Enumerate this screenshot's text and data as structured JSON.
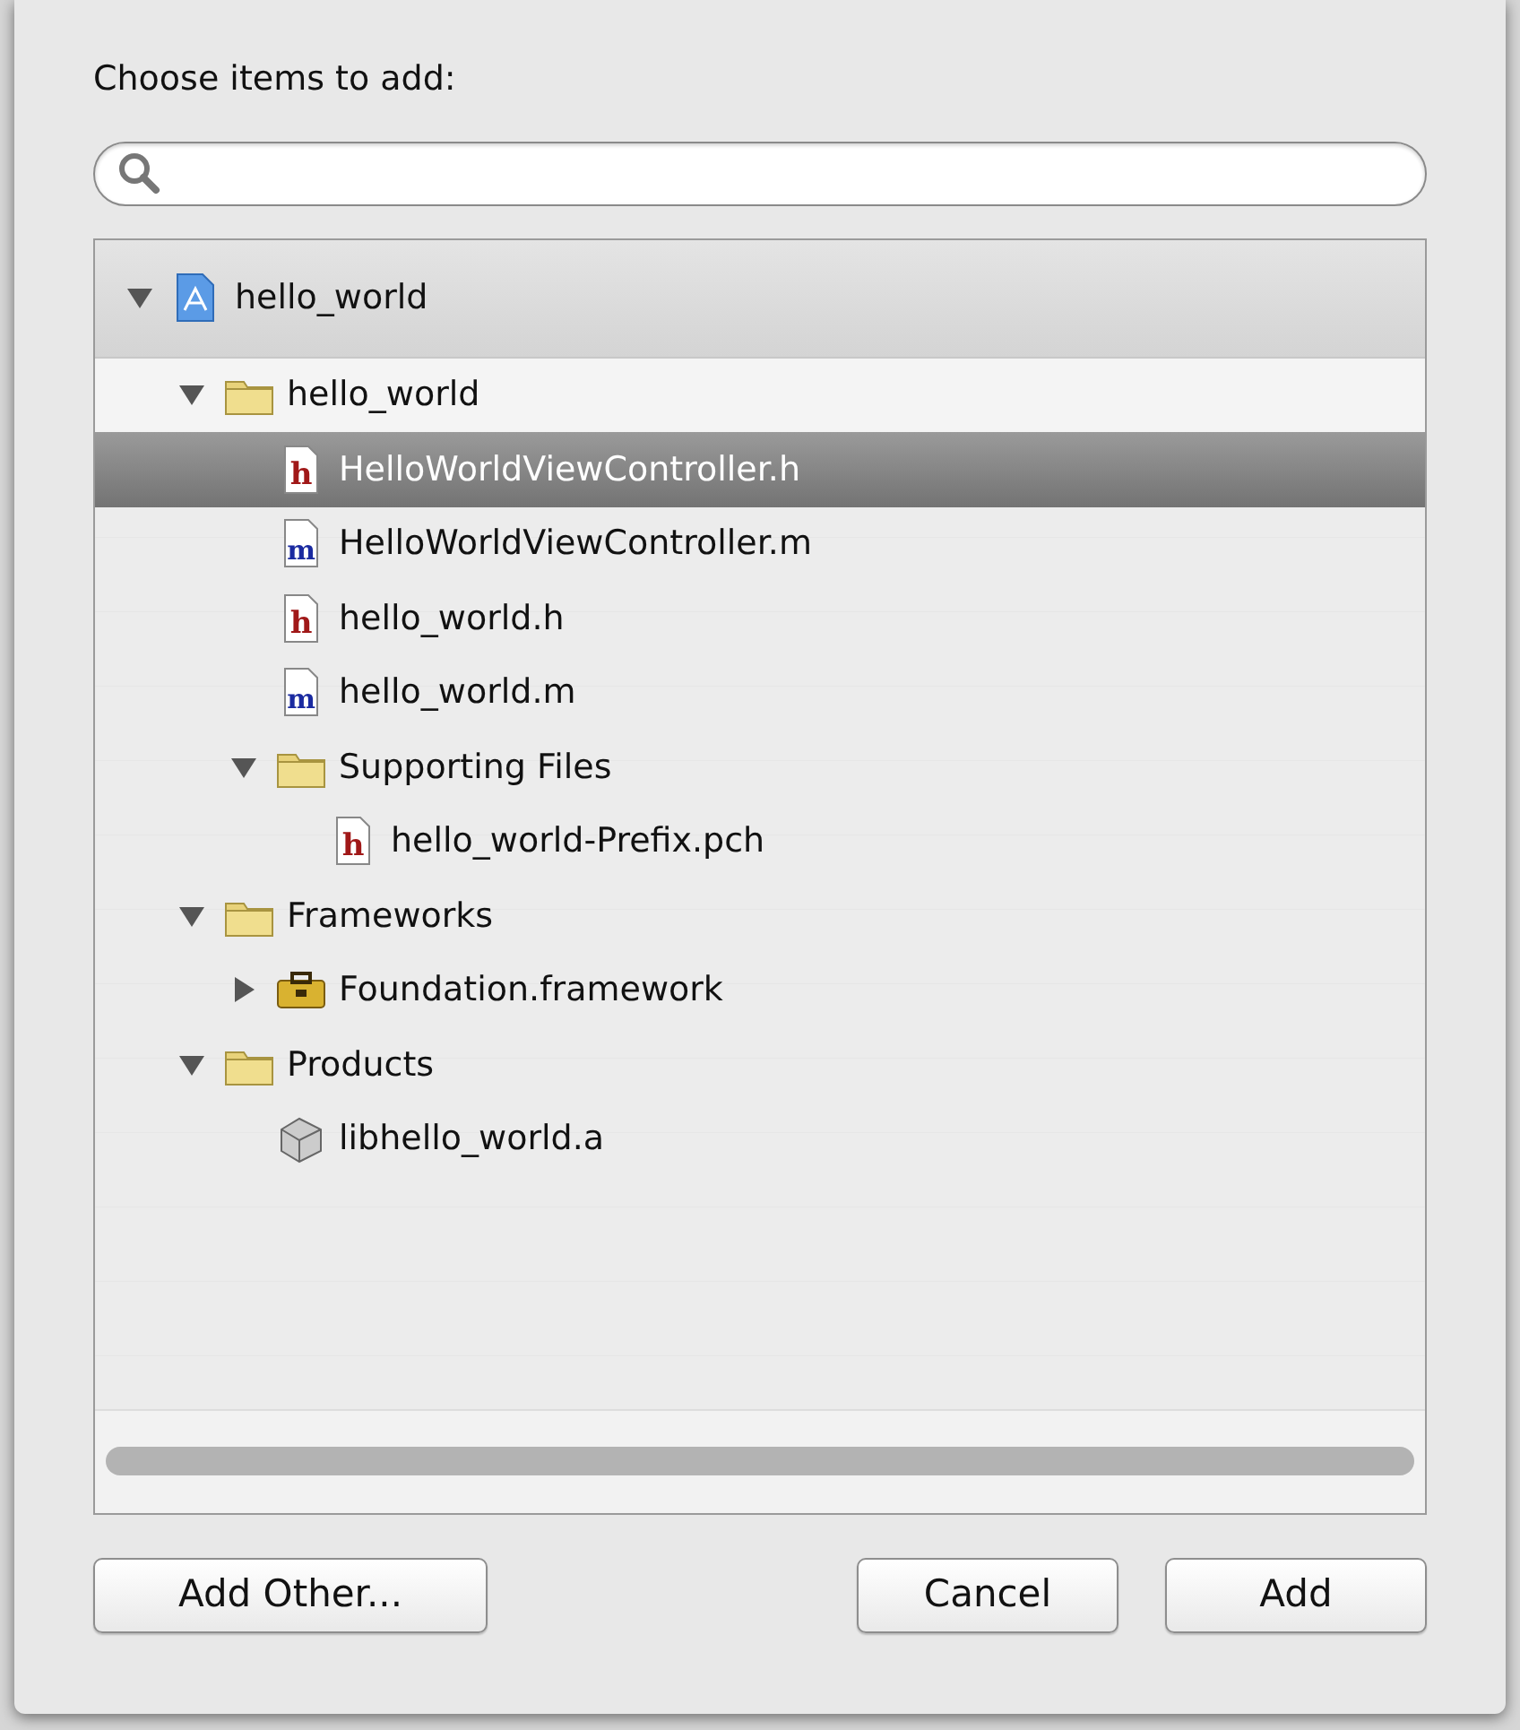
{
  "dialog": {
    "prompt": "Choose items to add:",
    "tree": [
      {
        "label": "hello_world",
        "kind": "project",
        "expanded": true,
        "selected": false,
        "children": [
          {
            "label": "hello_world",
            "kind": "folder",
            "expanded": true,
            "selected": false,
            "children": [
              {
                "label": "HelloWorldViewController.h",
                "kind": "header",
                "icon_letter": "h",
                "selected": true
              },
              {
                "label": "HelloWorldViewController.m",
                "kind": "source",
                "icon_letter": "m",
                "selected": false
              },
              {
                "label": "hello_world.h",
                "kind": "header",
                "icon_letter": "h",
                "selected": false
              },
              {
                "label": "hello_world.m",
                "kind": "source",
                "icon_letter": "m",
                "selected": false
              },
              {
                "label": "Supporting Files",
                "kind": "folder",
                "expanded": true,
                "selected": false,
                "children": [
                  {
                    "label": "hello_world-Prefix.pch",
                    "kind": "header",
                    "icon_letter": "h",
                    "selected": false
                  }
                ]
              }
            ]
          },
          {
            "label": "Frameworks",
            "kind": "folder",
            "expanded": true,
            "selected": false,
            "children": [
              {
                "label": "Foundation.framework",
                "kind": "framework",
                "expanded": false,
                "selected": false
              }
            ]
          },
          {
            "label": "Products",
            "kind": "folder",
            "expanded": true,
            "selected": false,
            "children": [
              {
                "label": "libhello_world.a",
                "kind": "library",
                "selected": false
              }
            ]
          }
        ]
      }
    ],
    "buttons": [
      {
        "label": "Add Other...",
        "kind": "left"
      },
      {
        "label": "Cancel",
        "kind": "right"
      },
      {
        "label": "Add",
        "kind": "right"
      }
    ]
  }
}
